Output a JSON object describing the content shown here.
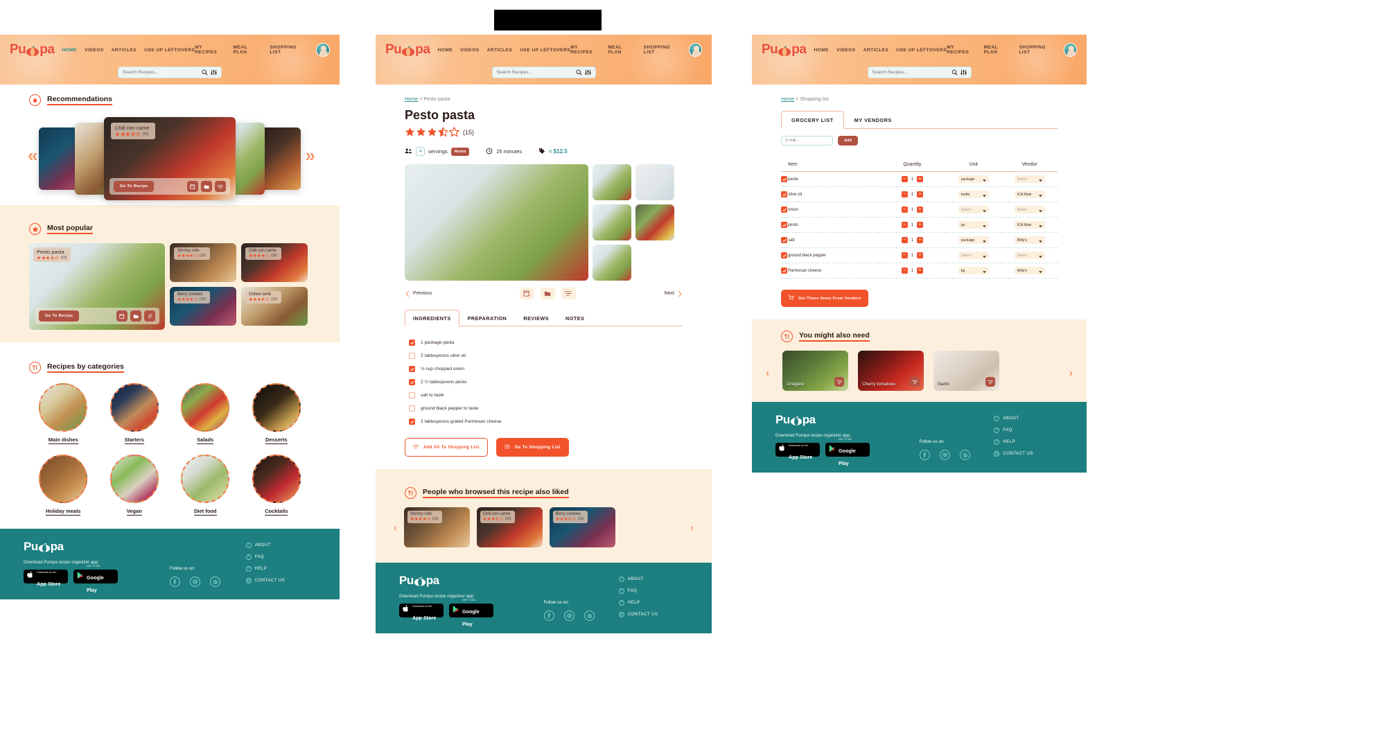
{
  "brand": {
    "name_left": "Pu",
    "name_right": "pa",
    "full": "Pumpa"
  },
  "header": {
    "nav": [
      {
        "label": "HOME",
        "active": true
      },
      {
        "label": "VIDEOS",
        "active": false
      },
      {
        "label": "ARTICLES",
        "active": false
      },
      {
        "label": "USE UP LEFTOVERS",
        "active": false
      }
    ],
    "nav_right": [
      {
        "label": "MY RECIPES"
      },
      {
        "label": "MEAL PLAN"
      },
      {
        "label": "SHOPPING LIST"
      }
    ],
    "search_placeholder": "Search Recipes...",
    "search_value": "",
    "icons": {
      "search": "search-icon",
      "filter": "filter-sliders-icon",
      "avatar": "user-avatar"
    }
  },
  "home": {
    "recommendations": {
      "title": "Recommendations",
      "icon": "flame-icon",
      "prev": "«",
      "next": "»",
      "featured": {
        "title": "Chili con carne",
        "rating": 3.5,
        "reviews": "(15)",
        "cta": "Go To Recipe",
        "photo": "ph-chili",
        "actions": [
          "add-to-meal-plan-icon",
          "add-to-folder-icon",
          "add-to-shopping-list-icon"
        ]
      },
      "side_photos": [
        "ph-berry",
        "ph-lamb",
        "ph-pesto",
        "ph-grill"
      ]
    },
    "popular": {
      "title": "Most popular",
      "icon": "star-badge-icon",
      "cards": [
        {
          "title": "Pesto pasta",
          "rating": 3.5,
          "reviews": "(15)",
          "photo": "ph-pesto",
          "cta": "Go To Recipe"
        },
        {
          "title": "Shrimp rolls",
          "rating": 3.5,
          "reviews": "(15)",
          "photo": "ph-shrimp"
        },
        {
          "title": "Chili con carne",
          "rating": 3.5,
          "reviews": "(15)",
          "photo": "ph-chili"
        },
        {
          "title": "Berry cookies",
          "rating": 3.5,
          "reviews": "(15)",
          "photo": "ph-berry"
        },
        {
          "title": "Grilled lamb",
          "rating": 3.5,
          "reviews": "(15)",
          "photo": "ph-lamb"
        }
      ]
    },
    "categories": {
      "title": "Recipes by categories",
      "icon": "cutlery-icon",
      "items": [
        {
          "label": "Main dishes",
          "photo": "ph-chicken"
        },
        {
          "label": "Starters",
          "photo": "ph-bruschetta"
        },
        {
          "label": "Salads",
          "photo": "ph-bowl"
        },
        {
          "label": "Desserts",
          "photo": "ph-dessert"
        },
        {
          "label": "Holiday meals",
          "photo": "ph-holiday"
        },
        {
          "label": "Vegan",
          "photo": "ph-vegan"
        },
        {
          "label": "Diet food",
          "photo": "ph-diet"
        },
        {
          "label": "Cocktails",
          "photo": "ph-cocktail"
        }
      ]
    }
  },
  "recipe": {
    "breadcrumb": {
      "home": "Home",
      "sep": ">",
      "current": "Pesto pasta"
    },
    "title": "Pesto pasta",
    "rating": 3.5,
    "reviews": "(15)",
    "servings_value": "4",
    "servings_label": "servings",
    "resize_label": "Resize",
    "time": "25 minutes",
    "price": "≈ $12.5",
    "prev_label": "Previous",
    "next_label": "Next",
    "tabs": [
      {
        "label": "INGREDIENTS",
        "active": true
      },
      {
        "label": "PREPARATION",
        "active": false
      },
      {
        "label": "REVIEWS",
        "active": false
      },
      {
        "label": "NOTES",
        "active": false
      }
    ],
    "ingredients": [
      {
        "text": "1 package pasta",
        "checked": true
      },
      {
        "text": "2 tablespoons olive oil",
        "checked": false
      },
      {
        "text": "½ cup chopped onion",
        "checked": true
      },
      {
        "text": "2 ½ tablespoons pesto",
        "checked": true
      },
      {
        "text": "salt to taste",
        "checked": false
      },
      {
        "text": "ground black pepper to taste",
        "checked": false
      },
      {
        "text": "2 tablespoons grated Parmesan cheese",
        "checked": true
      }
    ],
    "actions": [
      {
        "label": "Add All To Shopping List",
        "style": "ghost",
        "icon": "add-to-list-icon"
      },
      {
        "label": "Go To Shopping List",
        "style": "fill",
        "icon": "list-icon"
      }
    ],
    "liked": {
      "title": "People who browsed this recipe also liked",
      "icon": "cutlery-icon",
      "cards": [
        {
          "title": "Shrimp rolls",
          "rating": 3.5,
          "reviews": "(15)",
          "photo": "ph-shrimp"
        },
        {
          "title": "Chili con carne",
          "rating": 3.5,
          "reviews": "(15)",
          "photo": "ph-chili"
        },
        {
          "title": "Berry cookies",
          "rating": 3.5,
          "reviews": "(15)",
          "photo": "ph-berry"
        }
      ]
    }
  },
  "shopping": {
    "breadcrumb": {
      "home": "Home",
      "sep": ">",
      "current": "Shopping list"
    },
    "tabs": [
      {
        "label": "GROCERY LIST",
        "active": true
      },
      {
        "label": "MY VENDORS",
        "active": false
      }
    ],
    "add_placeholder": "1l milk...",
    "add_value": "",
    "add_label": "Add",
    "columns": [
      "Item",
      "Quantity",
      "Unit",
      "Vendor"
    ],
    "rows": [
      {
        "checked": true,
        "item": "pasta",
        "qty": "1",
        "unit": "package",
        "vendor": "Select"
      },
      {
        "checked": true,
        "item": "olive oil",
        "qty": "1",
        "unit": "bottle",
        "vendor": "ICA Maxi"
      },
      {
        "checked": true,
        "item": "onion",
        "qty": "1",
        "unit": "Select",
        "vendor": "Select"
      },
      {
        "checked": true,
        "item": "pesto",
        "qty": "1",
        "unit": "jar",
        "vendor": "ICA Maxi"
      },
      {
        "checked": true,
        "item": "salt",
        "qty": "1",
        "unit": "package",
        "vendor": "Willy's"
      },
      {
        "checked": true,
        "item": "ground black pepper",
        "qty": "1",
        "unit": "Select",
        "vendor": "Select"
      },
      {
        "checked": true,
        "item": "Parmesan cheese",
        "qty": "1",
        "unit": "kg",
        "vendor": "Willy's"
      }
    ],
    "get_button": "Get These Items From Vendors",
    "need": {
      "title": "You might also need",
      "icon": "cutlery-icon",
      "items": [
        {
          "label": "Oregano",
          "photo": "ph-oregano"
        },
        {
          "label": "Cherry tomatoes",
          "photo": "ph-tomato"
        },
        {
          "label": "Garlic",
          "photo": "ph-garlic"
        }
      ]
    }
  },
  "footer": {
    "tagline": "Download Pumpa recipe organizer app:",
    "stores": [
      {
        "small": "Download on the",
        "large": "App Store",
        "icon": "apple-icon"
      },
      {
        "small": "GET IT ON",
        "large": "Google Play",
        "icon": "google-play-icon"
      }
    ],
    "follow_label": "Follow us on:",
    "socials": [
      "facebook-icon",
      "instagram-icon",
      "pinterest-icon"
    ],
    "links": [
      "ABOUT",
      "FAQ",
      "HELP",
      "CONTACT US"
    ]
  },
  "colors": {
    "accent": "#f1522a",
    "brand_orange": "#e8503a",
    "teal": "#1d7f7f",
    "cream": "#fcefdd",
    "header_peach": "#f9a868",
    "brick": "#b05242"
  }
}
